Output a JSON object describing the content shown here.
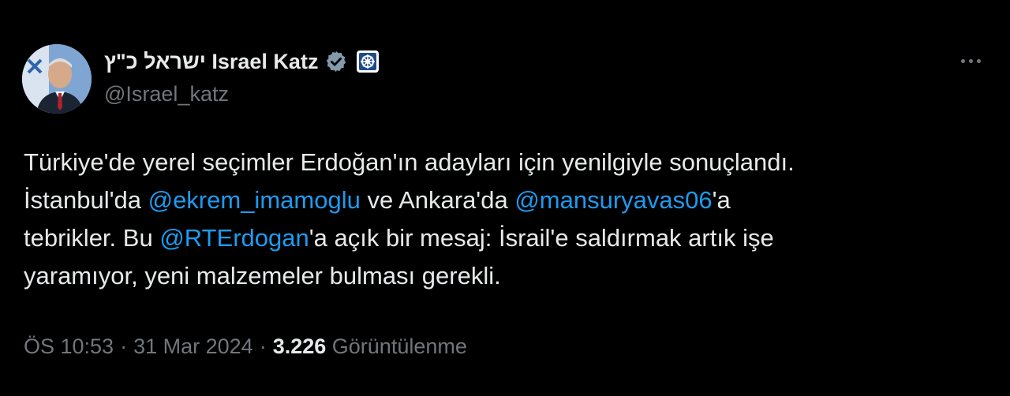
{
  "author": {
    "display_name": "ישראל כ\"ץ Israel Katz",
    "handle": "@Israel_katz",
    "verified_icon": "verified-badge-icon",
    "affiliation_icon": "government-affiliation-icon",
    "avatar": "profile-photo"
  },
  "tweet": {
    "line1": "Türkiye'de yerel seçimler Erdoğan'ın adayları için yenilgiyle sonuçlandı.",
    "line2_a": "İstanbul'da ",
    "mention1": "@ekrem_imamoglu",
    "line2_b": " ve Ankara'da ",
    "mention2": "@mansuryavas06",
    "line2_c": "'a",
    "line3_a": "tebrikler. Bu ",
    "mention3": "@RTErdogan",
    "line3_b": "'a açık bir mesaj: İsrail'e saldırmak artık işe",
    "line4": "yaramıyor, yeni malzemeler bulması gerekli."
  },
  "meta": {
    "time": "ÖS 10:53",
    "date": "31 Mar 2024",
    "separator": "·",
    "views_count": "3.226",
    "views_label": "Görüntülenme"
  },
  "colors": {
    "background": "#000000",
    "text": "#e7e9ea",
    "secondary": "#71767b",
    "link": "#1d9bf0"
  }
}
